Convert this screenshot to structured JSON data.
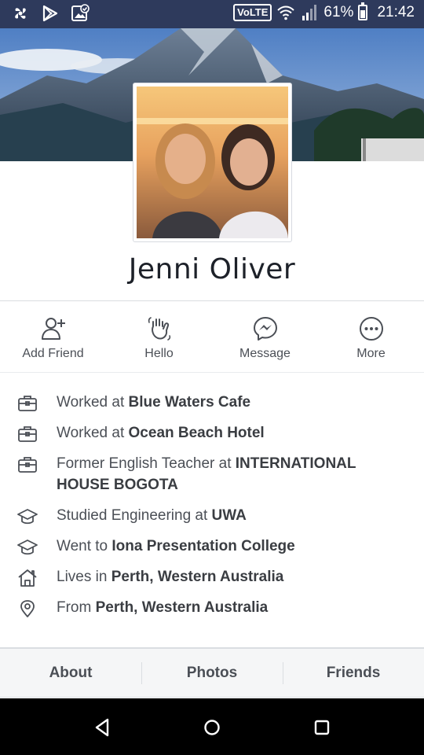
{
  "status_bar": {
    "volte": "VoLTE",
    "battery": "61%",
    "battery_level": 0.61,
    "time": "21:42",
    "icons": [
      "pinwheel-icon",
      "play-store-icon",
      "photo-check-icon",
      "wifi-icon",
      "signal-icon",
      "battery-icon"
    ]
  },
  "profile": {
    "name": "Jenni Oliver"
  },
  "actions": [
    {
      "label": "Add Friend",
      "icon": "add-friend-icon"
    },
    {
      "label": "Hello",
      "icon": "wave-hand-icon"
    },
    {
      "label": "Message",
      "icon": "messenger-icon"
    },
    {
      "label": "More",
      "icon": "more-icon"
    }
  ],
  "info": [
    {
      "icon": "briefcase-icon",
      "prefix": "Worked at ",
      "bold": "Blue Waters Cafe"
    },
    {
      "icon": "briefcase-icon",
      "prefix": "Worked at ",
      "bold": "Ocean Beach Hotel"
    },
    {
      "icon": "briefcase-icon",
      "prefix": "Former English Teacher at ",
      "bold": "INTERNATIONAL HOUSE BOGOTA"
    },
    {
      "icon": "graduation-cap-icon",
      "prefix": "Studied Engineering at ",
      "bold": "UWA"
    },
    {
      "icon": "graduation-cap-icon",
      "prefix": "Went to ",
      "bold": "Iona Presentation College"
    },
    {
      "icon": "home-icon",
      "prefix": "Lives in ",
      "bold": "Perth, Western Australia"
    },
    {
      "icon": "location-pin-icon",
      "prefix": "From ",
      "bold": "Perth, Western Australia"
    }
  ],
  "tabs": [
    {
      "label": "About"
    },
    {
      "label": "Photos"
    },
    {
      "label": "Friends"
    }
  ],
  "colors": {
    "status_bar": "#2e3a5c",
    "text_primary": "#1d2129",
    "text_secondary": "#4b4f56",
    "divider": "#dadde1"
  }
}
